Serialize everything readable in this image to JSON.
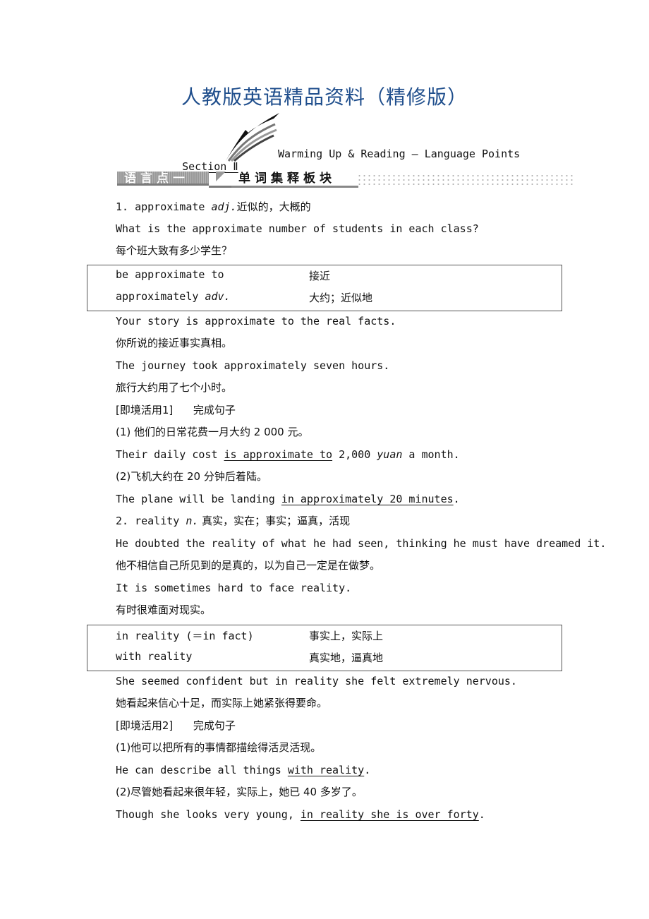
{
  "header": {
    "title": "人教版英语精品资料（精修版）",
    "section_label": "Section Ⅱ",
    "section_title": "Warming Up & Reading — Language Points"
  },
  "banner": {
    "tag": "语言点一",
    "heading": "单词集释板块"
  },
  "entries": [
    {
      "headline": {
        "num": "1. ",
        "word": "approximate ",
        "pos": "adj.",
        "meaning": "近似的，大概的"
      },
      "examples_before": [
        {
          "en": "What is the approximate number of students in each class?",
          "zh": "每个班大致有多少学生？"
        }
      ],
      "box": [
        {
          "phrase": "be approximate to",
          "pos": "",
          "meaning": "接近"
        },
        {
          "phrase": "approximately ",
          "pos": "adv.",
          "meaning": "大约；近似地"
        }
      ],
      "examples_after": [
        {
          "en": "Your story is approximate to the real facts.",
          "zh": "你所说的接近事实真相。"
        },
        {
          "en": "The journey took approximately seven hours.",
          "zh": "旅行大约用了七个小时。"
        }
      ],
      "exercise": {
        "label": "[即境活用1]",
        "task": "完成句子",
        "items": [
          {
            "zh": "(1) 他们的日常花费一月大约 2 000 元。",
            "pre": "Their daily cost ",
            "answer": "is approximate to",
            "post1": " 2,000 ",
            "post_it": "yuan",
            "post2": " a month."
          },
          {
            "zh": "(2)飞机大约在 20 分钟后着陆。",
            "pre": "The plane will be landing ",
            "answer": "in approximately 20 minutes",
            "post1": ".",
            "post_it": "",
            "post2": ""
          }
        ]
      }
    },
    {
      "headline": {
        "num": "2. ",
        "word": "reality ",
        "pos": "n.",
        "meaning": " 真实，实在；事实；逼真，活现"
      },
      "examples_before": [
        {
          "en": "He doubted the reality of what he had seen, thinking he must have dreamed it.",
          "zh": "他不相信自己所见到的是真的，以为自己一定是在做梦。"
        },
        {
          "en": "It is sometimes hard to face reality.",
          "zh": "有时很难面对现实。"
        }
      ],
      "box": [
        {
          "phrase": "in reality (＝in fact)",
          "pos": "",
          "meaning": "事实上，实际上"
        },
        {
          "phrase": "with reality",
          "pos": "",
          "meaning": "真实地，逼真地"
        }
      ],
      "examples_after": [
        {
          "en": "She seemed confident but in reality she felt extremely nervous.",
          "zh": "她看起来信心十足，而实际上她紧张得要命。"
        }
      ],
      "exercise": {
        "label": "[即境活用2]",
        "task": "完成句子",
        "items": [
          {
            "zh": "(1)他可以把所有的事情都描绘得活灵活现。",
            "pre": "He can describe all things ",
            "answer": "with reality",
            "post1": ".",
            "post_it": "",
            "post2": ""
          },
          {
            "zh": "(2)尽管她看起来很年轻，实际上，她已 40 多岁了。",
            "pre": "Though she looks very young, ",
            "answer": "in reality she is over forty",
            "post1": ".",
            "post_it": "",
            "post2": ""
          }
        ]
      }
    }
  ]
}
